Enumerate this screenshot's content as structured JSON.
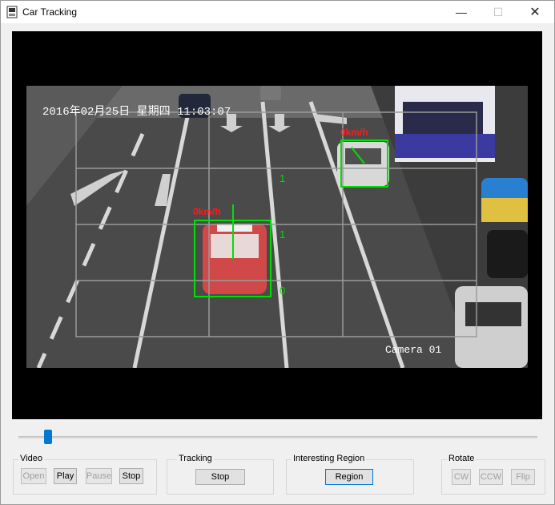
{
  "window": {
    "title": "Car Tracking",
    "controls": {
      "minimize": "—",
      "maximize": "☐",
      "close": "✕"
    }
  },
  "video": {
    "timestamp": "2016年02月25日 星期四  11:03:07",
    "camera_label": "Camera 01",
    "grid_numbers": {
      "first": "1",
      "second": "1",
      "third": "0"
    },
    "tracked_cars": [
      {
        "speed_label": "0km/h",
        "color": "#00e000"
      },
      {
        "speed_label": "0km/h",
        "color": "#00e000"
      }
    ],
    "overlay_text_color": "#ff1a1a",
    "track_box_color": "#00e000"
  },
  "seek_slider": {
    "position": 0.05,
    "accent": "#0078d7"
  },
  "controls": {
    "video": {
      "label": "Video",
      "open": "Open",
      "play": "Play",
      "pause": "Pause",
      "stop": "Stop"
    },
    "tracking": {
      "label": "Tracking",
      "stop": "Stop"
    },
    "region": {
      "label": "Interesting Region",
      "region": "Region"
    },
    "rotate": {
      "label": "Rotate",
      "cw": "CW",
      "ccw": "CCW",
      "flip": "Flip"
    }
  }
}
